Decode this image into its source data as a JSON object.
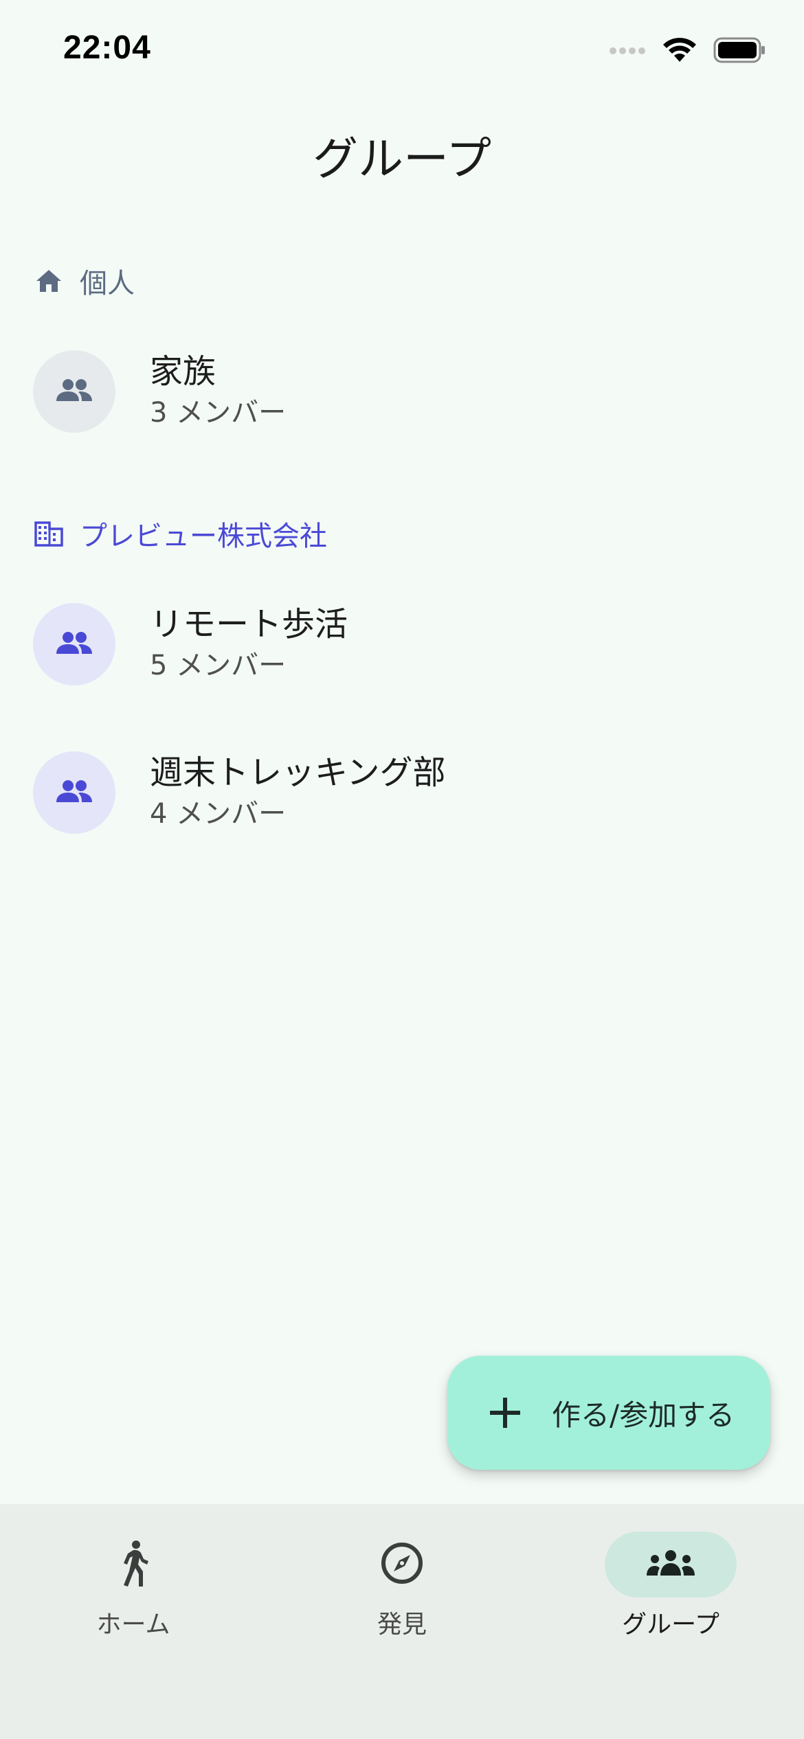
{
  "status_bar": {
    "time": "22:04"
  },
  "header": {
    "title": "グループ"
  },
  "sections": [
    {
      "label": "個人",
      "icon": "home-icon",
      "color": "#5c6b82",
      "groups": [
        {
          "name": "家族",
          "members": "3 メンバー"
        }
      ]
    },
    {
      "label": "プレビュー株式会社",
      "icon": "building-icon",
      "color": "#4a49d6",
      "groups": [
        {
          "name": "リモート歩活",
          "members": "5 メンバー"
        },
        {
          "name": "週末トレッキング部",
          "members": "4 メンバー"
        }
      ]
    }
  ],
  "fab": {
    "label": "作る/参加する",
    "icon": "plus-icon",
    "color": "#a3f0da"
  },
  "bottom_nav": {
    "items": [
      {
        "label": "ホーム",
        "icon": "walking-icon",
        "active": false
      },
      {
        "label": "発見",
        "icon": "compass-icon",
        "active": false
      },
      {
        "label": "グループ",
        "icon": "groups-icon",
        "active": true
      }
    ],
    "active_color": "#cde8df"
  }
}
